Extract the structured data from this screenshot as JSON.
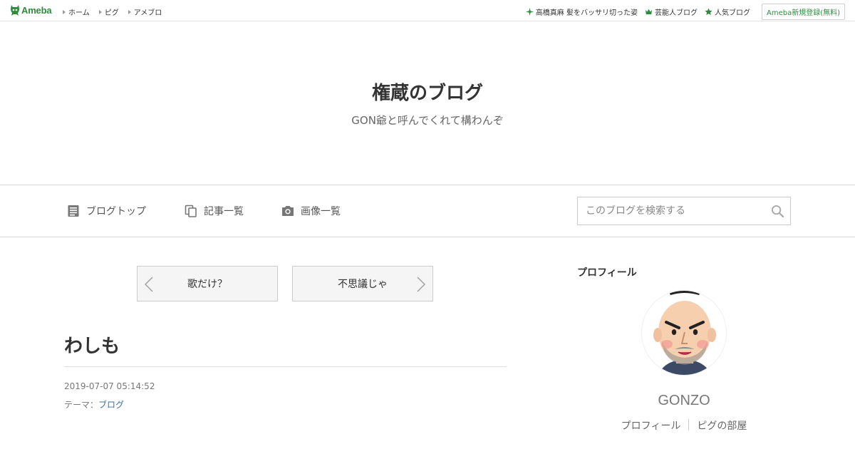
{
  "topbar": {
    "logo_text": "Ameba",
    "nav": [
      "ホーム",
      "ピグ",
      "アメブロ"
    ],
    "right_items": [
      {
        "icon": "sparkle-icon",
        "label": "高橋真麻 髪をバッサリ切った姿"
      },
      {
        "icon": "crown-icon",
        "label": "芸能人ブログ"
      },
      {
        "icon": "star-icon",
        "label": "人気ブログ"
      }
    ],
    "register_label": "Ameba新規登録(無料)",
    "accent": "#2d8c3c"
  },
  "header": {
    "title": "権蔵のブログ",
    "subtitle": "GON爺と呼んでくれて構わんぞ"
  },
  "nav": {
    "items": [
      {
        "icon": "document-icon",
        "label": "ブログトップ"
      },
      {
        "icon": "copy-icon",
        "label": "記事一覧"
      },
      {
        "icon": "camera-icon",
        "label": "画像一覧"
      }
    ],
    "search_placeholder": "このブログを検索する"
  },
  "pager": {
    "prev_label": "歌だけ？",
    "next_label": "不思議じゃ"
  },
  "article": {
    "title": "わしも",
    "date": "2019-07-07 05:14:52",
    "theme_prefix": "テーマ：",
    "theme_link": "ブログ"
  },
  "sidebar": {
    "heading": "プロフィール",
    "name": "GONZO",
    "links": [
      "プロフィール",
      "ピグの部屋"
    ]
  }
}
